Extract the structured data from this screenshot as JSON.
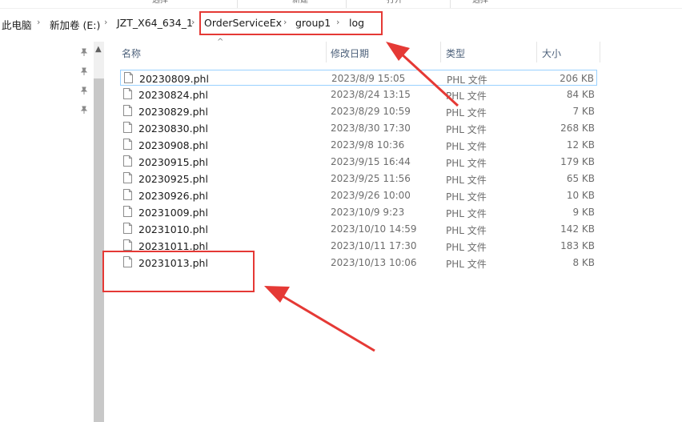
{
  "ribbon": {
    "labels": [
      "选择",
      "新建",
      "打开",
      "选择"
    ]
  },
  "breadcrumb": {
    "items": [
      "此电脑",
      "新加卷 (E:)",
      "JZT_X64_634_1",
      "OrderServiceEx",
      "group1",
      "log"
    ]
  },
  "columns": {
    "name": "名称",
    "date": "修改日期",
    "type": "类型",
    "size": "大小"
  },
  "files": [
    {
      "name": "20230809.phl",
      "date": "2023/8/9 15:05",
      "type": "PHL 文件",
      "size": "206 KB"
    },
    {
      "name": "20230824.phl",
      "date": "2023/8/24 13:15",
      "type": "PHL 文件",
      "size": "84 KB"
    },
    {
      "name": "20230829.phl",
      "date": "2023/8/29 10:59",
      "type": "PHL 文件",
      "size": "7 KB"
    },
    {
      "name": "20230830.phl",
      "date": "2023/8/30 17:30",
      "type": "PHL 文件",
      "size": "268 KB"
    },
    {
      "name": "20230908.phl",
      "date": "2023/9/8 10:36",
      "type": "PHL 文件",
      "size": "12 KB"
    },
    {
      "name": "20230915.phl",
      "date": "2023/9/15 16:44",
      "type": "PHL 文件",
      "size": "179 KB"
    },
    {
      "name": "20230925.phl",
      "date": "2023/9/25 11:56",
      "type": "PHL 文件",
      "size": "65 KB"
    },
    {
      "name": "20230926.phl",
      "date": "2023/9/26 10:00",
      "type": "PHL 文件",
      "size": "10 KB"
    },
    {
      "name": "20231009.phl",
      "date": "2023/10/9 9:23",
      "type": "PHL 文件",
      "size": "9 KB"
    },
    {
      "name": "20231010.phl",
      "date": "2023/10/10 14:59",
      "type": "PHL 文件",
      "size": "142 KB"
    },
    {
      "name": "20231011.phl",
      "date": "2023/10/11 17:30",
      "type": "PHL 文件",
      "size": "183 KB"
    },
    {
      "name": "20231013.phl",
      "date": "2023/10/13 10:06",
      "type": "PHL 文件",
      "size": "8 KB"
    }
  ],
  "colors": {
    "annotation": "#e53935",
    "selection_border": "#99d1ff",
    "header_text": "#4c607a"
  }
}
